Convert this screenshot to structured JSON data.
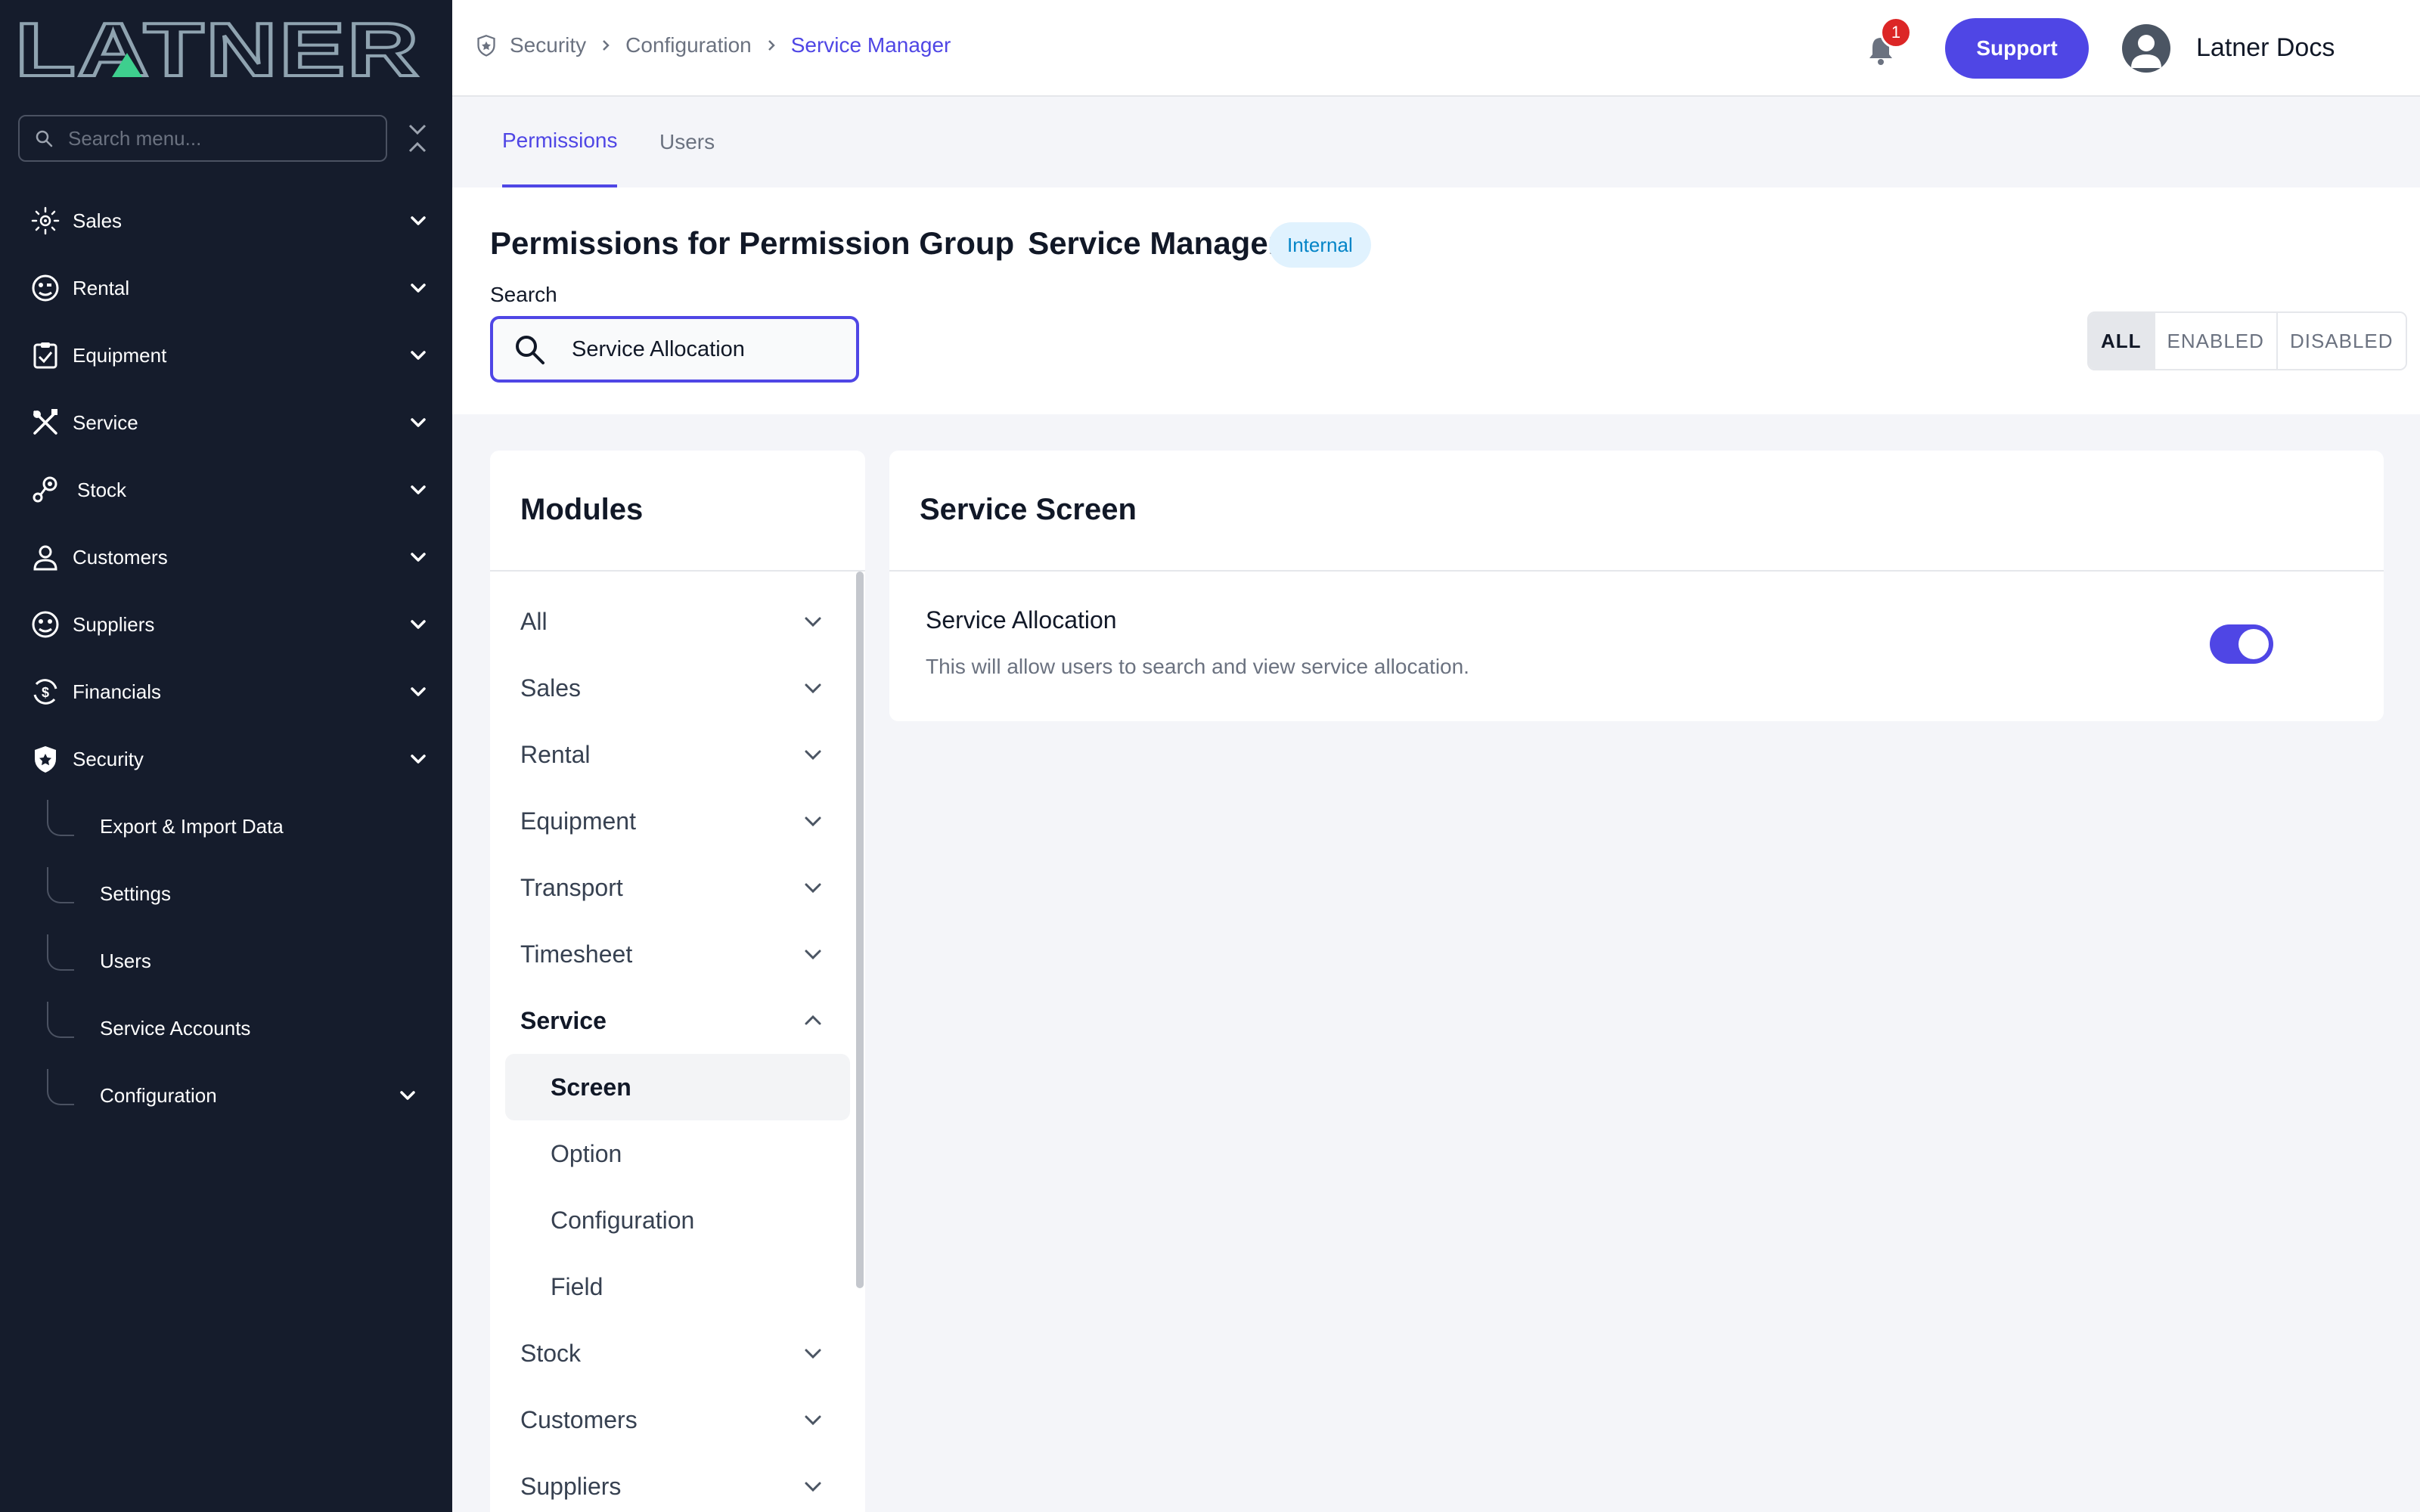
{
  "brand": {
    "name": "LATNER",
    "accent": "#4f46e5",
    "logo_green": "#3ecf8e"
  },
  "sidebar": {
    "search_placeholder": "Search menu...",
    "items": [
      {
        "label": "Sales",
        "icon": "sales-icon"
      },
      {
        "label": "Rental",
        "icon": "rental-icon"
      },
      {
        "label": "Equipment",
        "icon": "equipment-icon"
      },
      {
        "label": "Service",
        "icon": "service-icon"
      },
      {
        "label": "Stock",
        "icon": "stock-icon"
      },
      {
        "label": "Customers",
        "icon": "customers-icon"
      },
      {
        "label": "Suppliers",
        "icon": "suppliers-icon"
      },
      {
        "label": "Financials",
        "icon": "financials-icon"
      },
      {
        "label": "Security",
        "icon": "security-icon"
      }
    ],
    "security_children": [
      {
        "label": "Export & Import Data"
      },
      {
        "label": "Settings"
      },
      {
        "label": "Users"
      },
      {
        "label": "Service Accounts"
      },
      {
        "label": "Configuration"
      }
    ]
  },
  "header": {
    "breadcrumbs": [
      "Security",
      "Configuration",
      "Service Manager"
    ],
    "notification_count": "1",
    "support_label": "Support",
    "user_name": "Latner Docs"
  },
  "tabs": [
    {
      "label": "Permissions",
      "active": true
    },
    {
      "label": "Users",
      "active": false
    }
  ],
  "page": {
    "title_prefix": "Permissions for Permission Group",
    "title_group": "Service Manager",
    "badge": "Internal",
    "search_label": "Search",
    "search_value": "Service Allocation",
    "filters": [
      "ALL",
      "ENABLED",
      "DISABLED"
    ],
    "active_filter": "ALL"
  },
  "modules": {
    "title": "Modules",
    "items": [
      {
        "label": "All"
      },
      {
        "label": "Sales"
      },
      {
        "label": "Rental"
      },
      {
        "label": "Equipment"
      },
      {
        "label": "Transport"
      },
      {
        "label": "Timesheet"
      },
      {
        "label": "Service",
        "expanded": true
      }
    ],
    "service_children": [
      {
        "label": "Screen",
        "active": true
      },
      {
        "label": "Option"
      },
      {
        "label": "Configuration"
      },
      {
        "label": "Field"
      }
    ],
    "after_items": [
      {
        "label": "Stock"
      },
      {
        "label": "Customers"
      },
      {
        "label": "Suppliers"
      }
    ]
  },
  "screen_panel": {
    "title": "Service Screen",
    "permission": {
      "name": "Service Allocation",
      "description": "This will allow users to search and view service allocation.",
      "enabled": true
    }
  }
}
